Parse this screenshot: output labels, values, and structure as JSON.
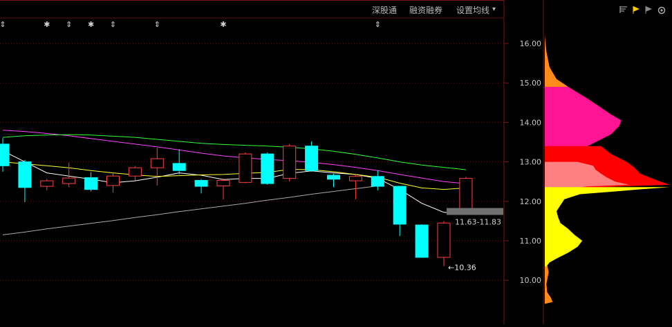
{
  "toolbar": {
    "items": [
      "深股通",
      "融资融券",
      "设置均线"
    ],
    "dropdown_glyph": "▾"
  },
  "pane_icons": [
    "list-icon",
    "yellow-flag-icon",
    "gray-flag-icon",
    "gear-icon"
  ],
  "event_markers": [
    {
      "symbol": "⇕",
      "at": 0
    },
    {
      "symbol": "✱",
      "at": 2
    },
    {
      "symbol": "⇕",
      "at": 3
    },
    {
      "symbol": "✱",
      "at": 4
    },
    {
      "symbol": "⇕",
      "at": 5
    },
    {
      "symbol": "⇕",
      "at": 7
    },
    {
      "symbol": "✱",
      "at": 10
    },
    {
      "symbol": "⇕",
      "at": 17
    }
  ],
  "chart_data": {
    "type": "candlestick",
    "y_range": [
      9.4,
      16.5
    ],
    "y_ticks": [
      "16.00",
      "15.00",
      "14.00",
      "13.00",
      "12.00",
      "11.00",
      "10.00"
    ],
    "candles": [
      {
        "open": 13.45,
        "close": 12.9,
        "high": 13.6,
        "low": 12.75,
        "dir": "down"
      },
      {
        "open": 13.0,
        "close": 12.35,
        "high": 13.05,
        "low": 11.98,
        "dir": "down"
      },
      {
        "open": 12.38,
        "close": 12.52,
        "high": 12.57,
        "low": 12.28,
        "dir": "up"
      },
      {
        "open": 12.45,
        "close": 12.59,
        "high": 12.98,
        "low": 12.36,
        "dir": "up"
      },
      {
        "open": 12.6,
        "close": 12.3,
        "high": 12.74,
        "low": 12.25,
        "dir": "down"
      },
      {
        "open": 12.4,
        "close": 12.64,
        "high": 12.72,
        "low": 12.22,
        "dir": "up"
      },
      {
        "open": 12.64,
        "close": 12.85,
        "high": 12.89,
        "low": 12.53,
        "dir": "up"
      },
      {
        "open": 12.85,
        "close": 13.08,
        "high": 13.35,
        "low": 12.4,
        "dir": "up"
      },
      {
        "open": 12.96,
        "close": 12.78,
        "high": 13.32,
        "low": 12.68,
        "dir": "down"
      },
      {
        "open": 12.53,
        "close": 12.38,
        "high": 12.56,
        "low": 12.2,
        "dir": "down"
      },
      {
        "open": 12.39,
        "close": 12.53,
        "high": 12.58,
        "low": 12.05,
        "dir": "up"
      },
      {
        "open": 12.48,
        "close": 13.2,
        "high": 13.24,
        "low": 12.46,
        "dir": "up"
      },
      {
        "open": 13.2,
        "close": 12.45,
        "high": 13.24,
        "low": 12.42,
        "dir": "down"
      },
      {
        "open": 12.58,
        "close": 13.4,
        "high": 13.45,
        "low": 12.5,
        "dir": "up"
      },
      {
        "open": 13.4,
        "close": 12.78,
        "high": 13.52,
        "low": 12.75,
        "dir": "down"
      },
      {
        "open": 12.66,
        "close": 12.56,
        "high": 12.7,
        "low": 12.36,
        "dir": "down"
      },
      {
        "open": 12.52,
        "close": 12.63,
        "high": 12.68,
        "low": 12.05,
        "dir": "up"
      },
      {
        "open": 12.63,
        "close": 12.38,
        "high": 12.78,
        "low": 12.28,
        "dir": "down"
      },
      {
        "open": 12.38,
        "close": 11.42,
        "high": 12.38,
        "low": 11.12,
        "dir": "down"
      },
      {
        "open": 11.4,
        "close": 10.58,
        "high": 11.42,
        "low": 10.57,
        "dir": "down"
      },
      {
        "open": 10.58,
        "close": 11.45,
        "high": 11.5,
        "low": 10.36,
        "dir": "up"
      },
      {
        "open": 11.82,
        "close": 12.58,
        "high": 12.62,
        "low": 11.8,
        "dir": "up"
      }
    ],
    "moving_averages": [
      {
        "color": "#ffffff",
        "values": [
          13.28,
          13.0,
          12.72,
          12.64,
          12.56,
          12.47,
          12.52,
          12.61,
          12.72,
          12.66,
          12.55,
          12.58,
          12.58,
          12.71,
          12.77,
          12.72,
          12.68,
          12.58,
          12.3,
          11.95,
          11.72,
          11.68
        ]
      },
      {
        "color": "#ffff33",
        "values": [
          13.0,
          12.95,
          12.9,
          12.85,
          12.78,
          12.72,
          12.67,
          12.63,
          12.65,
          12.67,
          12.68,
          12.71,
          12.73,
          12.81,
          12.8,
          12.75,
          12.68,
          12.61,
          12.46,
          12.34,
          12.3,
          12.34
        ]
      },
      {
        "color": "#ff44ff",
        "values": [
          13.8,
          13.77,
          13.72,
          13.66,
          13.59,
          13.52,
          13.45,
          13.38,
          13.3,
          13.22,
          13.15,
          13.1,
          13.06,
          13.03,
          12.99,
          12.93,
          12.86,
          12.78,
          12.68,
          12.59,
          12.5,
          12.45
        ]
      },
      {
        "color": "#33ff33",
        "values": [
          13.62,
          13.66,
          13.68,
          13.69,
          13.68,
          13.65,
          13.62,
          13.57,
          13.52,
          13.47,
          13.44,
          13.42,
          13.4,
          13.37,
          13.33,
          13.27,
          13.19,
          13.1,
          13.0,
          12.92,
          12.86,
          12.8
        ]
      },
      {
        "color": "#aaaaaa",
        "values": [
          11.15,
          11.22,
          11.3,
          11.37,
          11.44,
          11.51,
          11.59,
          11.66,
          11.74,
          11.81,
          11.88,
          11.95,
          12.03,
          12.1,
          12.18,
          12.25,
          12.32,
          12.39,
          null,
          null,
          null,
          null
        ]
      }
    ],
    "annotations": {
      "price_band": {
        "low": 11.63,
        "high": 11.83,
        "label": "11.63-11.83"
      },
      "low_label": {
        "value": 10.36,
        "text": "←10.36"
      }
    },
    "volume_profile": {
      "price_min": 9.4,
      "price_max": 16.2,
      "layers": [
        {
          "color": "#ff8c1a",
          "profile": [
            [
              16.2,
              0
            ],
            [
              15.8,
              0.02
            ],
            [
              15.4,
              0.06
            ],
            [
              15.1,
              0.15
            ],
            [
              14.9,
              0.3
            ],
            [
              14.6,
              0.4
            ],
            [
              14.3,
              0.43
            ],
            [
              14.0,
              0.42
            ],
            [
              13.7,
              0.4
            ],
            [
              13.4,
              0.37
            ],
            [
              13.2,
              0.33
            ],
            [
              13.0,
              0.24
            ],
            [
              12.8,
              0.14
            ],
            [
              12.6,
              0.08
            ],
            [
              12.4,
              0.04
            ],
            [
              12.2,
              0.02
            ],
            [
              12.0,
              0.01
            ],
            [
              11.0,
              0.01
            ],
            [
              10.5,
              0.02
            ],
            [
              10.2,
              0.05
            ],
            [
              9.9,
              0.02
            ],
            [
              9.7,
              0.03
            ],
            [
              9.55,
              0.08
            ],
            [
              9.45,
              0.1
            ],
            [
              9.4,
              0
            ]
          ]
        },
        {
          "color": "#ff1493",
          "profile": [
            [
              14.9,
              0.3
            ],
            [
              14.6,
              0.55
            ],
            [
              14.4,
              0.7
            ],
            [
              14.2,
              0.85
            ],
            [
              14.05,
              0.98
            ],
            [
              13.9,
              0.95
            ],
            [
              13.7,
              0.85
            ],
            [
              13.5,
              0.65
            ],
            [
              13.3,
              0.45
            ],
            [
              13.15,
              0.3
            ],
            [
              13.0,
              0.26
            ],
            [
              12.8,
              0.2
            ],
            [
              12.6,
              0.12
            ],
            [
              12.4,
              0.06
            ]
          ]
        },
        {
          "color": "#ff0000",
          "profile": [
            [
              13.4,
              0.72
            ],
            [
              13.2,
              0.85
            ],
            [
              13.0,
              1.05
            ],
            [
              12.85,
              1.15
            ],
            [
              12.7,
              1.22
            ],
            [
              12.6,
              1.35
            ],
            [
              12.5,
              1.48
            ],
            [
              12.42,
              1.6
            ],
            [
              12.35,
              0.6
            ],
            [
              12.2,
              0.12
            ]
          ]
        },
        {
          "color": "#ff8080",
          "profile": [
            [
              13.0,
              0.42
            ],
            [
              12.9,
              0.62
            ],
            [
              12.8,
              0.65
            ],
            [
              12.7,
              0.72
            ],
            [
              12.6,
              0.8
            ],
            [
              12.5,
              0.9
            ],
            [
              12.42,
              1.08
            ],
            [
              12.38,
              0.55
            ],
            [
              12.3,
              0.22
            ],
            [
              12.1,
              0.1
            ],
            [
              11.95,
              0.04
            ]
          ]
        },
        {
          "color": "#ffff00",
          "profile": [
            [
              12.36,
              1.6
            ],
            [
              12.3,
              1.2
            ],
            [
              12.25,
              0.9
            ],
            [
              12.18,
              0.45
            ],
            [
              12.05,
              0.25
            ],
            [
              11.9,
              0.2
            ],
            [
              11.75,
              0.15
            ],
            [
              11.6,
              0.17
            ],
            [
              11.45,
              0.2
            ],
            [
              11.3,
              0.3
            ],
            [
              11.15,
              0.38
            ],
            [
              11.0,
              0.48
            ],
            [
              10.85,
              0.42
            ],
            [
              10.7,
              0.3
            ],
            [
              10.55,
              0.15
            ],
            [
              10.45,
              0.06
            ],
            [
              10.35,
              0.02
            ]
          ]
        }
      ]
    }
  }
}
